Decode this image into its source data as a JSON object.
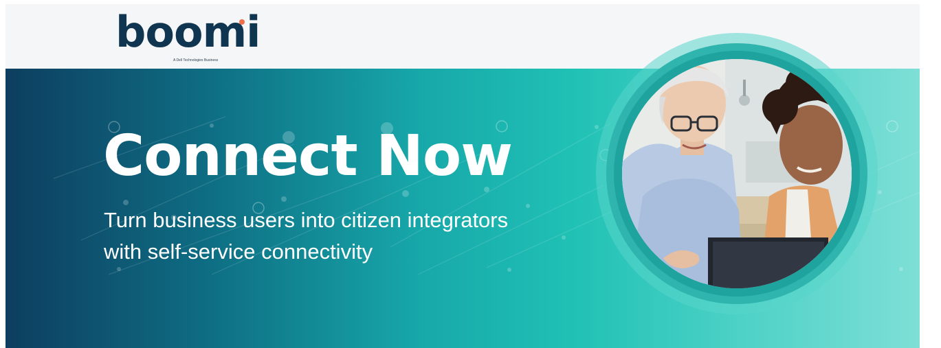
{
  "logo": {
    "wordmark": "boomi",
    "tagline": "A Dell Technologies Business"
  },
  "banner": {
    "headline": "Connect Now",
    "subhead_line1": "Turn business users into citizen integrators",
    "subhead_line2": "with self-service connectivity"
  },
  "colors": {
    "brand_navy": "#0f3550",
    "logo_accent": "#ef6f4c",
    "gradient_start": "#0d3e5f",
    "gradient_mid": "#20c1b5",
    "gradient_end": "#7edfd6"
  },
  "photo": {
    "subject": "two women smiling at a computer monitor"
  }
}
